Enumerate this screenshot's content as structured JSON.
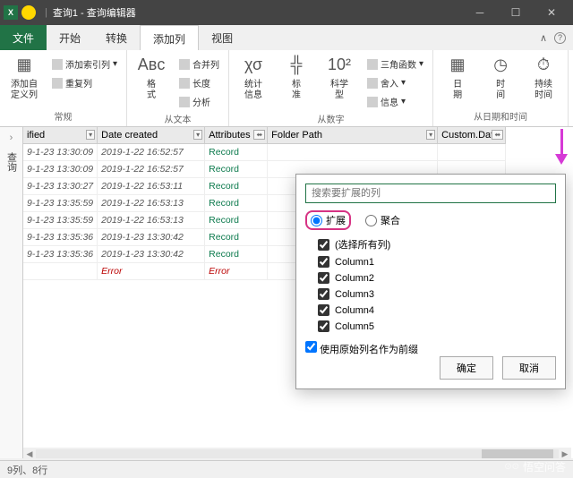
{
  "window": {
    "title": "查询1 - 查询编辑器"
  },
  "menu": {
    "file": "文件",
    "home": "开始",
    "transform": "转换",
    "addcol": "添加列",
    "view": "视图"
  },
  "ribbon": {
    "general": {
      "addcustom": "添加自\n定义列",
      "addindex": "添加索引列",
      "duplicate": "重复列",
      "label": "常规"
    },
    "fromtext": {
      "format": "格\n式",
      "merge": "合并列",
      "length": "长度",
      "analyze": "分析",
      "label": "从文本"
    },
    "fromnumber": {
      "stats": "统计\n信息",
      "std": "标\n准",
      "sci": "科学\n型",
      "info": "信息",
      "trig": "三角函数",
      "round": "舍入",
      "label": "从数字"
    },
    "fromdatetime": {
      "date": "日\n期",
      "time": "时\n间",
      "duration": "持续\n时间",
      "label": "从日期和时间"
    }
  },
  "sidebar": {
    "label": "查询"
  },
  "columns": {
    "modified": "ified",
    "created": "Date created",
    "attributes": "Attributes",
    "folderpath": "Folder Path",
    "customdata": "Custom.Data"
  },
  "rows": [
    {
      "m": "9-1-23 13:30:09",
      "c": "2019-1-22 16:52:57",
      "a": "Record"
    },
    {
      "m": "9-1-23 13:30:09",
      "c": "2019-1-22 16:52:57",
      "a": "Record"
    },
    {
      "m": "9-1-23 13:30:27",
      "c": "2019-1-22 16:53:11",
      "a": "Record"
    },
    {
      "m": "9-1-23 13:35:59",
      "c": "2019-1-22 16:53:13",
      "a": "Record"
    },
    {
      "m": "9-1-23 13:35:59",
      "c": "2019-1-22 16:53:13",
      "a": "Record"
    },
    {
      "m": "9-1-23 13:35:36",
      "c": "2019-1-23 13:30:42",
      "a": "Record"
    },
    {
      "m": "9-1-23 13:35:36",
      "c": "2019-1-23 13:30:42",
      "a": "Record"
    },
    {
      "m": "",
      "c": "Error",
      "a": "Error",
      "err": true
    }
  ],
  "expand": {
    "search_ph": "搜索要扩展的列",
    "radio_expand": "扩展",
    "radio_aggregate": "聚合",
    "select_all": "(选择所有列)",
    "cols": [
      "Column1",
      "Column2",
      "Column3",
      "Column4",
      "Column5"
    ],
    "prefix": "使用原始列名作为前缀",
    "ok": "确定",
    "cancel": "取消"
  },
  "status": "9列、8行",
  "watermark": "悟空问答"
}
